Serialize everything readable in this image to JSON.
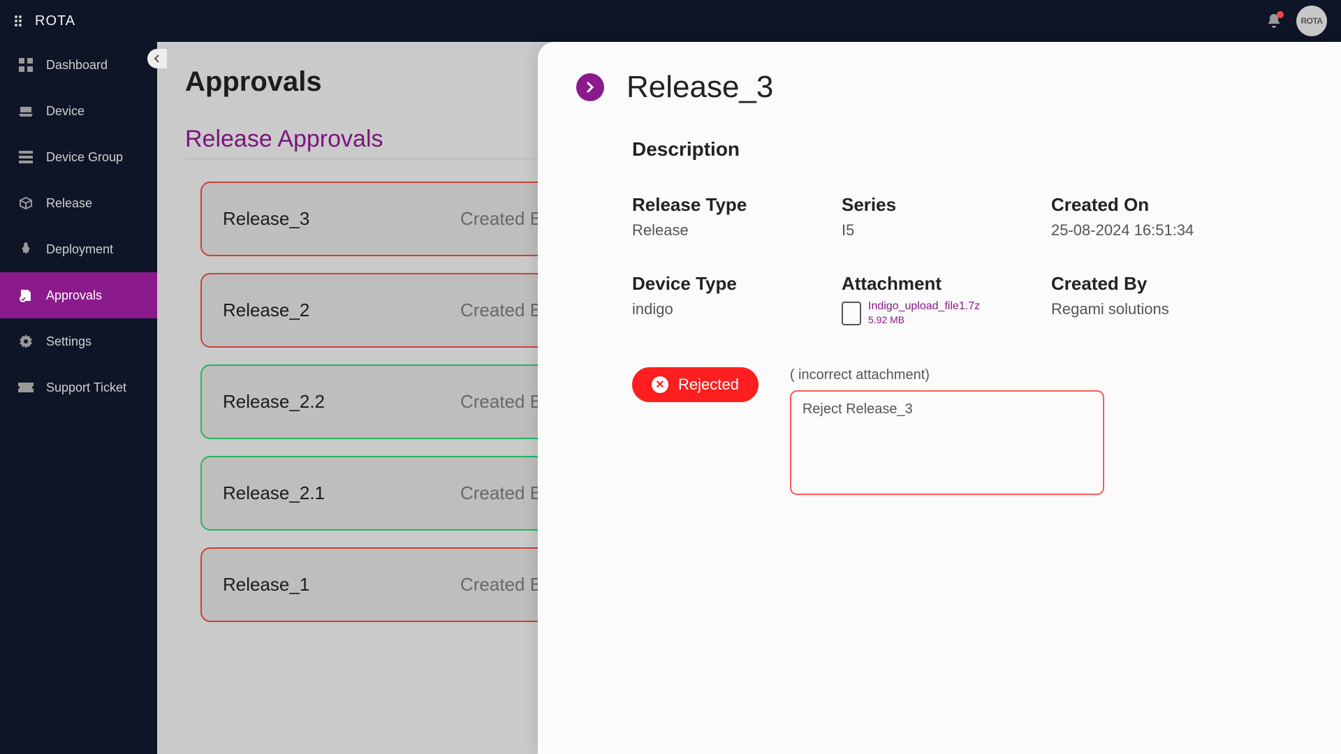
{
  "brand": {
    "name": "ROTA"
  },
  "avatar": {
    "text": "ROTA"
  },
  "sidebar": {
    "items": [
      {
        "label": "Dashboard"
      },
      {
        "label": "Device"
      },
      {
        "label": "Device Group"
      },
      {
        "label": "Release"
      },
      {
        "label": "Deployment"
      },
      {
        "label": "Approvals"
      },
      {
        "label": "Settings"
      },
      {
        "label": "Support Ticket"
      }
    ]
  },
  "main": {
    "page_title": "Approvals",
    "section_title": "Release Approvals",
    "cards": [
      {
        "name": "Release_3",
        "by_label": "Created By",
        "status": "rejected"
      },
      {
        "name": "Release_2",
        "by_label": "Created By",
        "status": "rejected"
      },
      {
        "name": "Release_2.2",
        "by_label": "Created By",
        "status": "approved"
      },
      {
        "name": "Release_2.1",
        "by_label": "Created By",
        "status": "approved"
      },
      {
        "name": "Release_1",
        "by_label": "Created By",
        "status": "rejected"
      }
    ]
  },
  "panel": {
    "title": "Release_3",
    "description_label": "Description",
    "fields": {
      "release_type": {
        "label": "Release Type",
        "value": "Release"
      },
      "series": {
        "label": "Series",
        "value": "I5"
      },
      "created_on": {
        "label": "Created On",
        "value": "25-08-2024 16:51:34"
      },
      "device_type": {
        "label": "Device Type",
        "value": "indigo"
      },
      "attachment": {
        "label": "Attachment",
        "file_name": "Indigo_upload_file1.7z",
        "file_size": "5.92 MB"
      },
      "created_by": {
        "label": "Created By",
        "value": "Regami solutions"
      }
    },
    "status": {
      "label": "Rejected",
      "reason_note": "( incorrect attachment)",
      "reason_text": "Reject Release_3"
    }
  },
  "colors": {
    "accent": "#8b1a8c",
    "danger": "#ff1f1f",
    "success": "#2ecc71"
  }
}
